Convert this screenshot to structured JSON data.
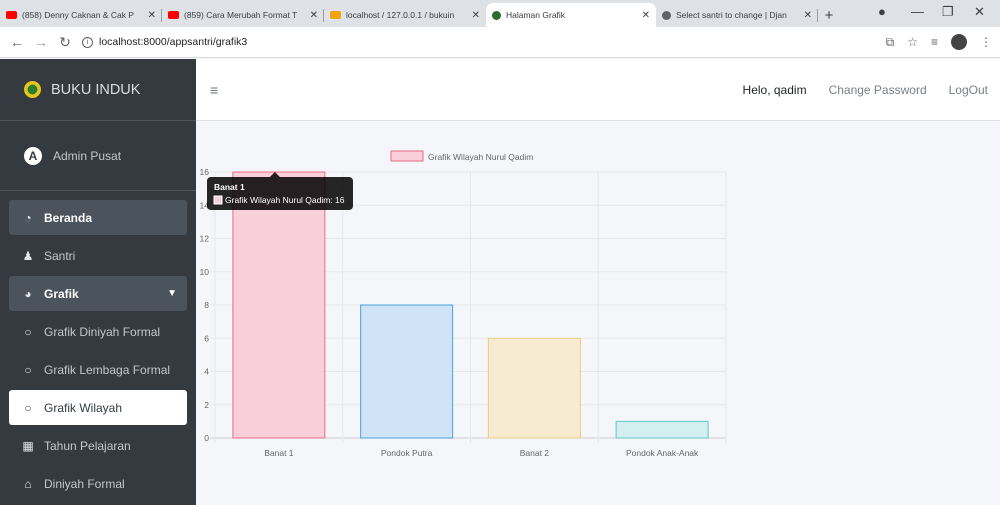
{
  "browser": {
    "tabs": [
      {
        "title": "(858) Denny Caknan & Cak P",
        "favicon_color": "#ff0000",
        "active": false
      },
      {
        "title": "(859) Cara Merubah Format T",
        "favicon_color": "#ff0000",
        "active": false
      },
      {
        "title": "localhost / 127.0.0.1 / bukuin",
        "favicon_color": "#f0a30a",
        "active": false
      },
      {
        "title": "Halaman Grafik",
        "favicon_color": "#2d6a2d",
        "active": true
      },
      {
        "title": "Select santri to change | Djan",
        "favicon_color": "#5f6368",
        "active": false
      }
    ],
    "url": "localhost:8000/appsantri/grafik3"
  },
  "sidebar": {
    "brand": "BUKU INDUK",
    "user": "Admin Pusat",
    "items": [
      {
        "label": "Beranda",
        "icon": "dashboard-icon"
      },
      {
        "label": "Santri",
        "icon": "user-icon"
      },
      {
        "label": "Grafik",
        "icon": "pie-chart-icon"
      },
      {
        "label": "Grafik Diniyah Formal",
        "icon": "circle-icon"
      },
      {
        "label": "Grafik Lembaga Formal",
        "icon": "circle-icon"
      },
      {
        "label": "Grafik Wilayah",
        "icon": "circle-icon"
      },
      {
        "label": "Tahun Pelajaran",
        "icon": "calendar-icon"
      },
      {
        "label": "Diniyah Formal",
        "icon": "school-icon"
      }
    ]
  },
  "header": {
    "greeting": "Helo, qadim",
    "change_password": "Change Password",
    "logout": "LogOut"
  },
  "chart_data": {
    "type": "bar",
    "categories": [
      "Banat 1",
      "Pondok Putra",
      "Banat 2",
      "Pondok Anak-Anak"
    ],
    "series": [
      {
        "name": "Grafik Wilayah Nurul Qadim",
        "values": [
          16,
          8,
          6,
          1
        ]
      }
    ],
    "bar_colors": [
      "#f7d0da",
      "#cfe4f6",
      "#f7ecd2",
      "#d3efef"
    ],
    "bar_borders": [
      "#ee6a8a",
      "#4ba0e0",
      "#eccd7e",
      "#66c7c7"
    ],
    "ylim": [
      0,
      16
    ],
    "yticks": [
      0,
      2,
      4,
      6,
      8,
      10,
      12,
      14,
      16
    ],
    "legend_position": "top",
    "grid": true,
    "tooltip": {
      "title": "Banat 1",
      "text": "Grafik Wilayah Nurul Qadim: 16"
    }
  }
}
